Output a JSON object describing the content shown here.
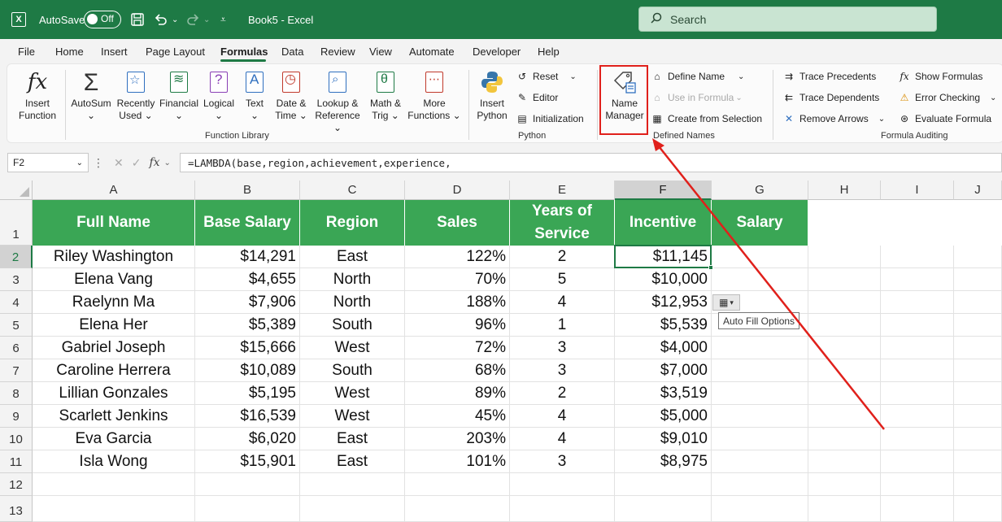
{
  "titlebar": {
    "app_logo": "excel-logo-icon",
    "logo_glyph": "X",
    "autosave_label": "AutoSave",
    "autosave_state": "Off",
    "doc_title": "Book5  -  Excel",
    "search_placeholder": "Search"
  },
  "tabs": [
    "File",
    "Home",
    "Insert",
    "Page Layout",
    "Formulas",
    "Data",
    "Review",
    "View",
    "Automate",
    "Developer",
    "Help"
  ],
  "active_tab": "Formulas",
  "ribbon": {
    "function_library": {
      "label": "Function Library",
      "insert_function": [
        "Insert",
        "Function"
      ],
      "autosum": [
        "AutoSum",
        "⌄"
      ],
      "recently_used": [
        "Recently",
        "Used ⌄"
      ],
      "financial": [
        "Financial",
        "⌄"
      ],
      "logical": [
        "Logical",
        "⌄"
      ],
      "text": [
        "Text",
        "⌄"
      ],
      "date_time": [
        "Date &",
        "Time ⌄"
      ],
      "lookup": [
        "Lookup &",
        "Reference ⌄"
      ],
      "math": [
        "Math &",
        "Trig ⌄"
      ],
      "more": [
        "More",
        "Functions ⌄"
      ]
    },
    "python": {
      "label": "Python",
      "insert_python": [
        "Insert",
        "Python"
      ],
      "reset": "Reset",
      "editor": "Editor",
      "initialization": "Initialization"
    },
    "defined_names": {
      "label": "Defined Names",
      "name_manager": [
        "Name",
        "Manager"
      ],
      "define_name": "Define Name",
      "use_in_formula": "Use in Formula",
      "create_from_selection": "Create from Selection"
    },
    "formula_auditing": {
      "label": "Formula Auditing",
      "trace_precedents": "Trace Precedents",
      "trace_dependents": "Trace Dependents",
      "remove_arrows": "Remove Arrows",
      "show_formulas": "Show Formulas",
      "error_checking": "Error Checking",
      "evaluate_formula": "Evaluate Formula"
    }
  },
  "formula_bar": {
    "name_box": "F2",
    "fx_label": "fx",
    "formula": "=LAMBDA(base,region,achievement,experience,"
  },
  "grid": {
    "columns": [
      "A",
      "B",
      "C",
      "D",
      "E",
      "F",
      "G",
      "H",
      "I",
      "J"
    ],
    "rows": [
      "1",
      "2",
      "3",
      "4",
      "5",
      "6",
      "7",
      "8",
      "9",
      "10",
      "11",
      "12",
      "13"
    ],
    "headers": [
      "Full Name",
      "Base Salary",
      "Region",
      "Sales",
      "Years of Service",
      "Incentive",
      "Salary"
    ],
    "header_years_line1": "Years of",
    "header_years_line2": "Service",
    "data": [
      [
        "Riley Washington",
        "$14,291",
        "East",
        "122%",
        "2",
        "$11,145"
      ],
      [
        "Elena Vang",
        "$4,655",
        "North",
        "70%",
        "5",
        "$10,000"
      ],
      [
        "Raelynn Ma",
        "$7,906",
        "North",
        "188%",
        "4",
        "$12,953"
      ],
      [
        "Elena Her",
        "$5,389",
        "South",
        "96%",
        "1",
        "$5,539"
      ],
      [
        "Gabriel Joseph",
        "$15,666",
        "West",
        "72%",
        "3",
        "$4,000"
      ],
      [
        "Caroline Herrera",
        "$10,089",
        "South",
        "68%",
        "3",
        "$7,000"
      ],
      [
        "Lillian Gonzales",
        "$5,195",
        "West",
        "89%",
        "2",
        "$3,519"
      ],
      [
        "Scarlett Jenkins",
        "$16,539",
        "West",
        "45%",
        "4",
        "$5,000"
      ],
      [
        "Eva Garcia",
        "$6,020",
        "East",
        "203%",
        "4",
        "$9,010"
      ],
      [
        "Isla Wong",
        "$15,901",
        "East",
        "101%",
        "3",
        "$8,975"
      ]
    ],
    "header_color": "#3aa655"
  },
  "autofill_tooltip": "Auto Fill Options",
  "accent_color": "#1e7a45",
  "annotation_color": "#e0201b"
}
